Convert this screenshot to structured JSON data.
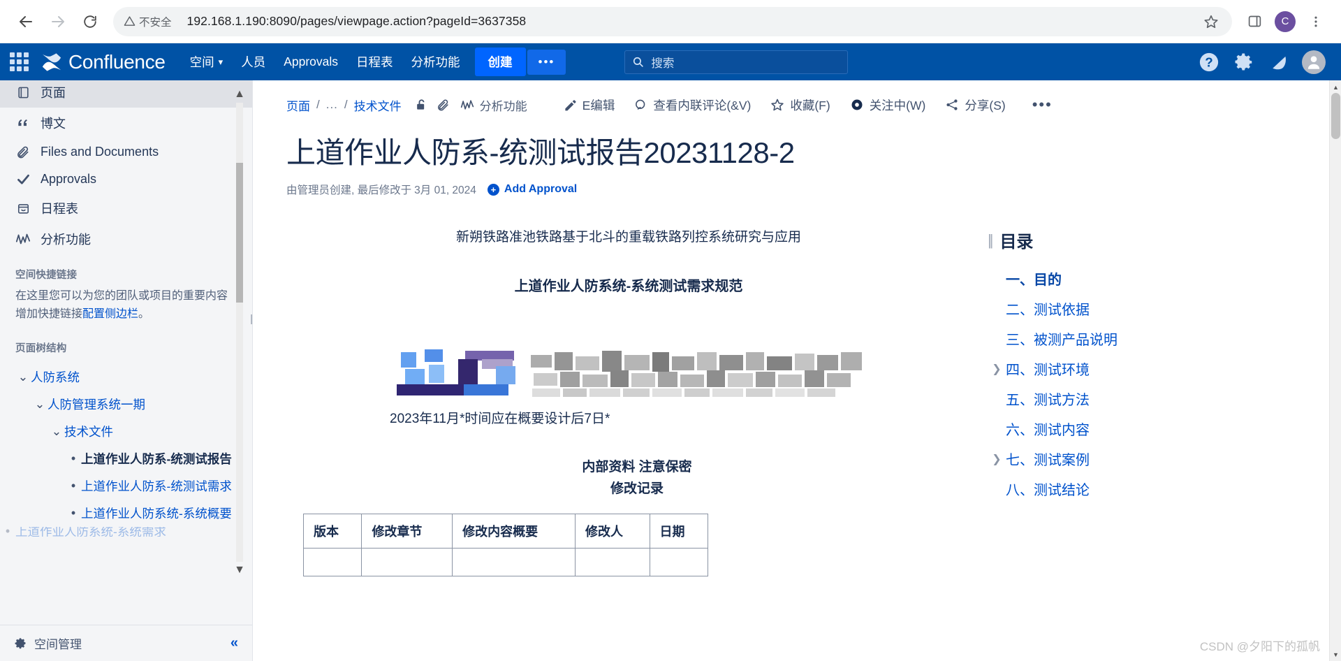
{
  "browser": {
    "back_icon": "arrow-left-icon",
    "forward_icon": "arrow-right-icon",
    "reload_icon": "reload-icon",
    "security_label": "不安全",
    "security_icon": "warning-triangle-icon",
    "url": "192.168.1.190:8090/pages/viewpage.action?pageId=3637358",
    "bookmark_icon": "star-icon",
    "sidepanel_icon": "side-panel-icon",
    "profile_initial": "C",
    "menu_icon": "kebab-menu-icon"
  },
  "topnav": {
    "app_switcher": "app-switcher-icon",
    "brand": "Confluence",
    "items": [
      {
        "label": "空间",
        "caret": "▾"
      },
      {
        "label": "人员",
        "caret": ""
      },
      {
        "label": "Approvals",
        "caret": ""
      },
      {
        "label": "日程表",
        "caret": ""
      },
      {
        "label": "分析功能",
        "caret": ""
      }
    ],
    "create_label": "创建",
    "more_label": "•••",
    "search_placeholder": "搜索",
    "right_icons": [
      "help-icon",
      "gear-icon",
      "notification-bell-icon",
      "user-avatar-icon"
    ]
  },
  "sidebar": {
    "items": [
      {
        "label": "页面",
        "icon": "page-icon",
        "active": true
      },
      {
        "label": "博文",
        "icon": "blog-quote-icon",
        "active": false
      },
      {
        "label": "Files and Documents",
        "icon": "paperclip-icon",
        "active": false
      },
      {
        "label": "Approvals",
        "icon": "check-icon",
        "active": false
      },
      {
        "label": "日程表",
        "icon": "calendar-icon",
        "active": false
      },
      {
        "label": "分析功能",
        "icon": "analytics-icon",
        "active": false
      }
    ],
    "shortcuts_title": "空间快捷链接",
    "shortcuts_desc_1": "在这里您可以为您的团队或项目的重要内容",
    "shortcuts_desc_2": "增加快捷链接",
    "shortcuts_link": "配置侧边栏",
    "shortcuts_desc_3": "。",
    "tree_title": "页面树结构",
    "tree": [
      {
        "label": "人防系统",
        "level": 1,
        "marker": "caret-down",
        "current": false
      },
      {
        "label": "人防管理系统一期",
        "level": 2,
        "marker": "caret-down",
        "current": false
      },
      {
        "label": "技术文件",
        "level": 3,
        "marker": "caret-down",
        "current": false
      },
      {
        "label": "上道作业人防系-统测试报告",
        "level": 4,
        "marker": "bullet",
        "current": true
      },
      {
        "label": "上道作业人防系-统测试需求",
        "level": 4,
        "marker": "bullet",
        "current": false
      },
      {
        "label": "上道作业人防系统-系统概要",
        "level": 4,
        "marker": "bullet",
        "current": false
      },
      {
        "label": "上道作业人防系统-系统需求",
        "level": 4,
        "marker": "bullet",
        "current": false
      }
    ],
    "footer_label": "空间管理",
    "footer_icon": "gear-icon",
    "collapse_icon": "double-chevron-left-icon"
  },
  "breadcrumb": {
    "root": "页面",
    "dots": "...",
    "parent": "技术文件",
    "icons": [
      "unlock-icon",
      "paperclip-icon"
    ],
    "analytics_label": "分析功能",
    "analytics_icon": "analytics-icon"
  },
  "actions": [
    {
      "label": "E编辑",
      "icon": "pencil-icon",
      "underline": "E"
    },
    {
      "label": "查看内联评论(&V)",
      "icon": "comment-search-icon",
      "underline": ""
    },
    {
      "label": "收藏(F)",
      "icon": "star-outline-icon",
      "underline": "F"
    },
    {
      "label": "关注中(W)",
      "icon": "eye-icon",
      "underline": "W"
    },
    {
      "label": "分享(S)",
      "icon": "share-icon",
      "underline": "S"
    }
  ],
  "actions_more": "•••",
  "page": {
    "title": "上道作业人防系-统测试报告20231128-2",
    "meta_prefix": "由 ",
    "meta_author": "管理员",
    "meta_middle": "创建, 最后修改于",
    "meta_date": "3月 01, 2024",
    "add_approval": "Add Approval",
    "add_approval_icon": "plus-circle-icon"
  },
  "document": {
    "heading_project": "新朔铁路准池铁路基于北斗的重载铁路列控系统研究与应用",
    "heading_doc": "上道作业人防系统-系统测试需求规范",
    "logo_alt": "blurred-company-logo",
    "date_bold": "2023年11月*时间应在概要设计后",
    "date_rest": "7日*",
    "confidential": "内部资料 注意保密",
    "revision_title": "修改记录",
    "table_headers": [
      "版本",
      "修改章节",
      "修改内容概要",
      "修改人",
      "日期"
    ],
    "table_rows": [
      [
        "",
        "",
        "",
        "",
        ""
      ]
    ]
  },
  "toc": {
    "title": "目录",
    "items": [
      {
        "label": "一、目的",
        "caret": false,
        "current": true
      },
      {
        "label": "二、测试依据",
        "caret": false,
        "current": false
      },
      {
        "label": "三、被测产品说明",
        "caret": false,
        "current": false
      },
      {
        "label": "四、测试环境",
        "caret": true,
        "current": false
      },
      {
        "label": "五、测试方法",
        "caret": false,
        "current": false
      },
      {
        "label": "六、测试内容",
        "caret": false,
        "current": false
      },
      {
        "label": "七、测试案例",
        "caret": true,
        "current": false
      },
      {
        "label": "八、测试结论",
        "caret": false,
        "current": false
      }
    ]
  },
  "watermark": "CSDN @夕阳下的孤帆",
  "colors": {
    "nav_blue": "#0052a5",
    "create_blue": "#0065ff",
    "link_blue": "#0052cc",
    "sidebar_bg": "#f4f5f7",
    "text_dark": "#172b4d"
  }
}
